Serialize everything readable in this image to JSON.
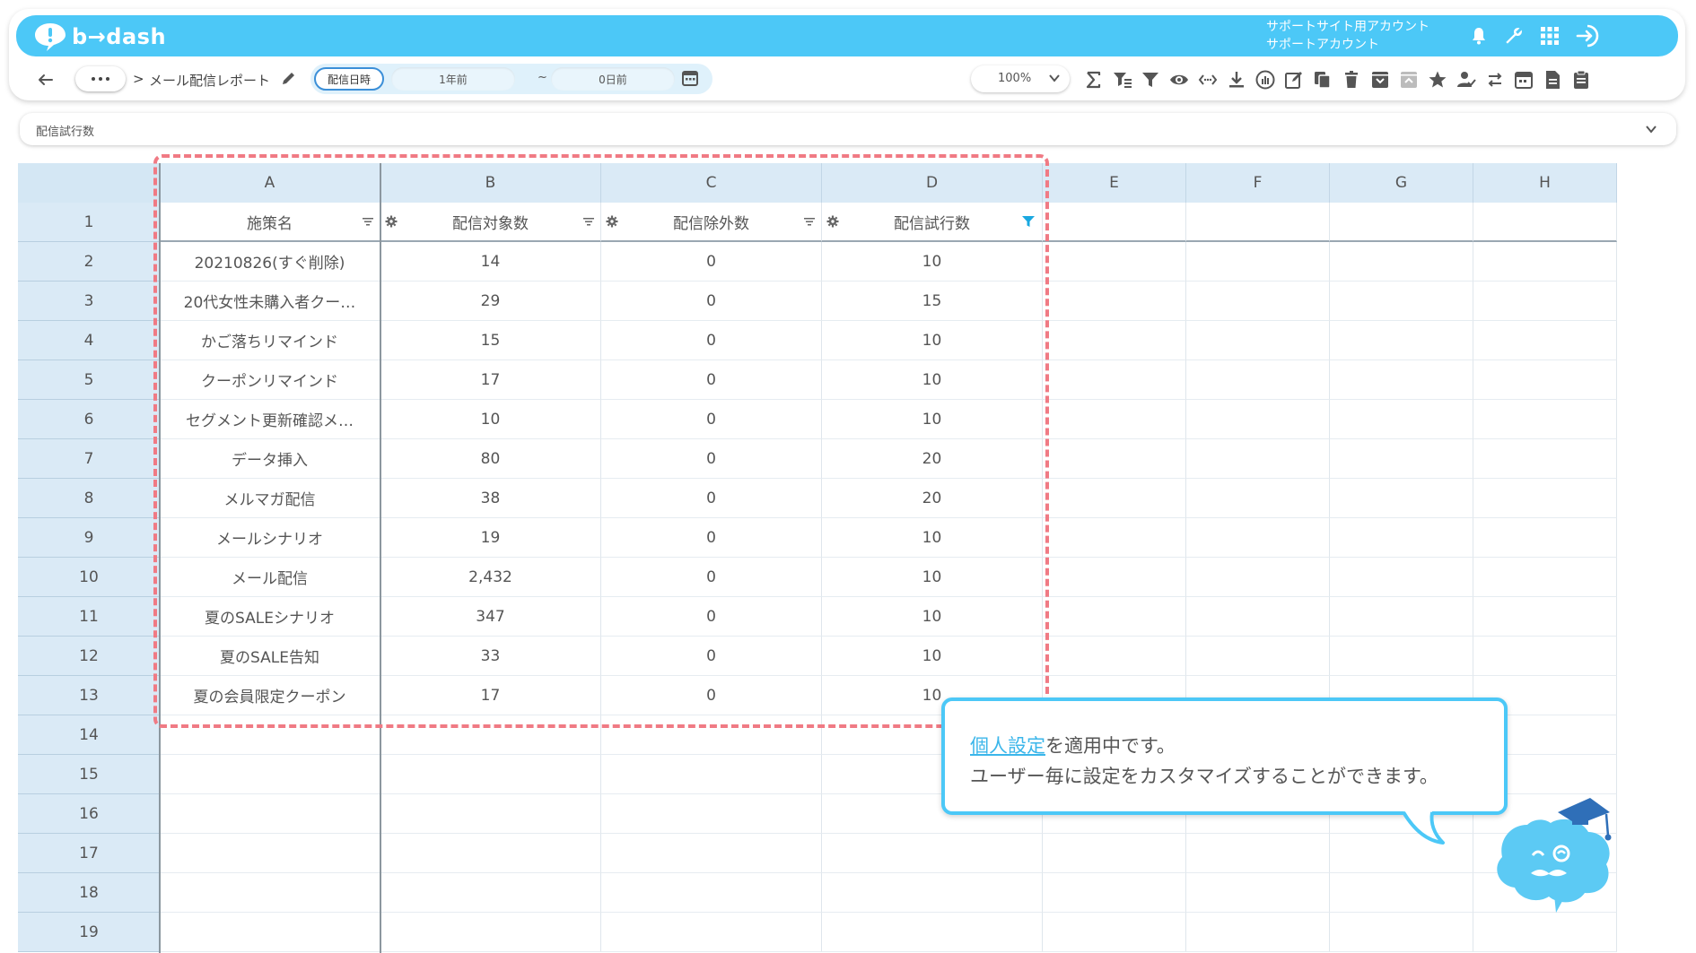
{
  "app": {
    "logo_text": "b→dash"
  },
  "account": {
    "line1": "サポートサイト用アカウント",
    "line2": "サポートアカウント"
  },
  "top_icons": [
    "bell-icon",
    "wrench-icon",
    "apps-grid-icon",
    "logout-icon"
  ],
  "breadcrumb": {
    "more": "...",
    "separator": ">",
    "title": "メール配信レポート"
  },
  "date_filter": {
    "label": "配信日時",
    "from": "1年前",
    "tilde": "~",
    "to": "0日前"
  },
  "zoom": {
    "value": "100%"
  },
  "toolbar_icons": [
    "sigma-icon",
    "filter-settings-icon",
    "filter-icon",
    "eye-icon",
    "code-icon",
    "download-icon",
    "chart-icon",
    "edit-icon",
    "copy-icon",
    "trash-icon",
    "archive-icon",
    "archive-disabled-icon",
    "star-icon",
    "person-check-icon",
    "swap-icon",
    "calendar-icon",
    "document-icon",
    "clipboard-icon"
  ],
  "filter_bar": {
    "text": "配信試行数"
  },
  "grid": {
    "columns": [
      "A",
      "B",
      "C",
      "D",
      "E",
      "F",
      "G",
      "H"
    ],
    "row_numbers": [
      "1",
      "2",
      "3",
      "4",
      "5",
      "6",
      "7",
      "8",
      "9",
      "10",
      "11",
      "12",
      "13",
      "14",
      "15",
      "16",
      "17",
      "18",
      "19"
    ],
    "headers": [
      "施策名",
      "配信対象数",
      "配信除外数",
      "配信試行数"
    ],
    "rows": [
      [
        "20210826(すぐ削除)",
        "14",
        "0",
        "10"
      ],
      [
        "20代女性未購入者クー…",
        "29",
        "0",
        "15"
      ],
      [
        "かご落ちリマインド",
        "15",
        "0",
        "10"
      ],
      [
        "クーポンリマインド",
        "17",
        "0",
        "10"
      ],
      [
        "セグメント更新確認メ…",
        "10",
        "0",
        "10"
      ],
      [
        "データ挿入",
        "80",
        "0",
        "20"
      ],
      [
        "メルマガ配信",
        "38",
        "0",
        "20"
      ],
      [
        "メールシナリオ",
        "19",
        "0",
        "10"
      ],
      [
        "メール配信",
        "2,432",
        "0",
        "10"
      ],
      [
        "夏のSALEシナリオ",
        "347",
        "0",
        "10"
      ],
      [
        "夏のSALE告知",
        "33",
        "0",
        "10"
      ],
      [
        "夏の会員限定クーポン",
        "17",
        "0",
        "10"
      ]
    ]
  },
  "tooltip": {
    "link": "個人設定",
    "line1_rest": "を適用中です。",
    "line2": "ユーザー毎に設定をカスタマイズすることができます。"
  },
  "colors": {
    "brand": "#4cc8f7",
    "accent_dash": "#f07a84",
    "header_bg": "#daeaf6"
  }
}
